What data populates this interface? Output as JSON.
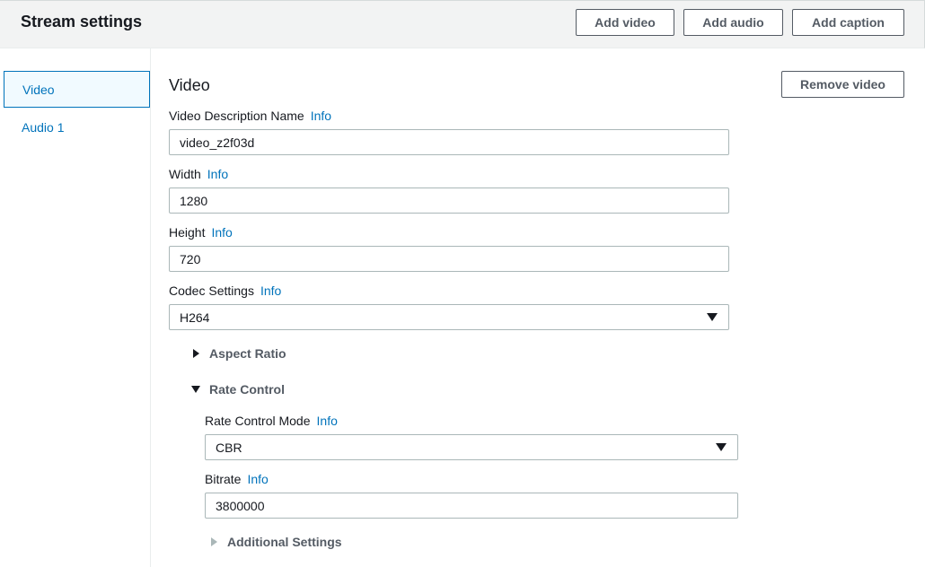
{
  "header": {
    "title": "Stream settings",
    "add_video": "Add video",
    "add_audio": "Add audio",
    "add_caption": "Add caption"
  },
  "sidebar": {
    "items": [
      {
        "label": "Video",
        "active": true
      },
      {
        "label": "Audio 1",
        "active": false
      }
    ]
  },
  "video": {
    "section_title": "Video",
    "remove_button": "Remove video",
    "info_link": "Info",
    "description_name": {
      "label": "Video Description Name",
      "value": "video_z2f03d"
    },
    "width": {
      "label": "Width",
      "value": "1280"
    },
    "height": {
      "label": "Height",
      "value": "720"
    },
    "codec": {
      "label": "Codec Settings",
      "value": "H264"
    },
    "aspect_ratio": {
      "label": "Aspect Ratio",
      "expanded": false
    },
    "rate_control": {
      "label": "Rate Control",
      "expanded": true,
      "mode": {
        "label": "Rate Control Mode",
        "value": "CBR"
      },
      "bitrate": {
        "label": "Bitrate",
        "value": "3800000"
      }
    },
    "additional_settings": {
      "label": "Additional Settings",
      "expanded": false
    }
  },
  "colors": {
    "link": "#0073bb",
    "header_bg": "#f2f3f3",
    "active_nav_bg": "#f1faff",
    "border": "#aab7b8",
    "text": "#16191f",
    "button_text": "#545b64"
  }
}
